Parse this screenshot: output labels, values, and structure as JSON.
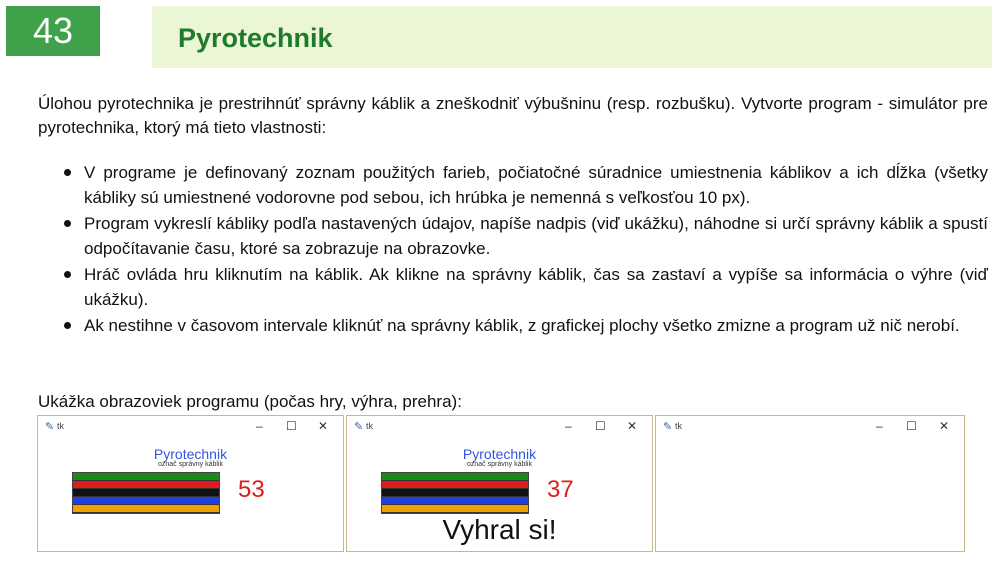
{
  "header": {
    "number": "43",
    "title": "Pyrotechnik"
  },
  "intro": "Úlohou pyrotechnika je prestrihnúť správny káblik a zneškodniť výbušninu (resp. rozbušku). Vytvorte program - simulátor pre pyrotechnika, ktorý má tieto vlastnosti:",
  "bullets": [
    "V programe je definovaný zoznam použitých farieb, počiatočné súradnice umiestnenia káblikov a ich dĺžka (všetky kábliky sú umiestnené vodorovne pod sebou, ich hrúbka je nemenná s veľkosťou 10 px).",
    "Program vykreslí kábliky podľa nastavených údajov, napíše nadpis (viď ukážku), náhodne si určí správny káblik a spustí odpočítavanie času, ktoré sa zobrazuje na obrazovke.",
    "Hráč ovláda hru kliknutím na káblik. Ak klikne na správny káblik, čas sa zastaví a vypíše sa informácia o výhre (viď ukážku).",
    "Ak nestihne v časovom intervale kliknúť na správny káblik, z grafickej plochy všetko zmizne a program už nič nerobí."
  ],
  "caption": "Ukážka obrazoviek programu (počas hry, výhra, prehra):",
  "window_common": {
    "tk_label": "tk",
    "minimize": "–",
    "maximize": "☐",
    "close": "✕"
  },
  "wire_colors": [
    "#1a8a1a",
    "#e01b1b",
    "#111111",
    "#1f3fe0",
    "#f0a000"
  ],
  "screens": [
    {
      "title": "Pyrotechnik",
      "subtitle": "označ správny káblik",
      "time": "53",
      "message": ""
    },
    {
      "title": "Pyrotechnik",
      "subtitle": "označ správny káblik",
      "time": "37",
      "message": "Vyhral si!"
    },
    {
      "title": "",
      "subtitle": "",
      "time": "",
      "message": ""
    }
  ]
}
